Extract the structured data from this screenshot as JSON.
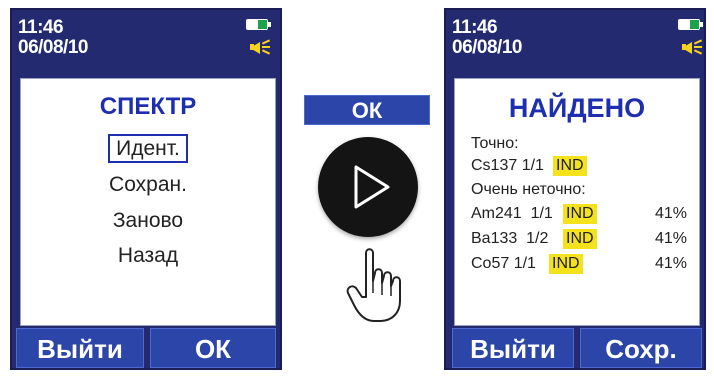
{
  "left_screen": {
    "time": "11:46",
    "date": "06/08/10",
    "title": "СПЕКТР",
    "menu": [
      "Идент.",
      "Сохран.",
      "Заново",
      "Назад"
    ],
    "selected_index": 0,
    "softkeys": {
      "left": "Выйти",
      "right": "ОК"
    }
  },
  "center": {
    "ok_label": "ОК",
    "icons": [
      "play-icon",
      "hand-pointer-icon"
    ]
  },
  "right_screen": {
    "time": "11:46",
    "date": "06/08/10",
    "title": "НАЙДЕНО",
    "exact_label": "Точно:",
    "exact": [
      {
        "nuclide": "Cs137 1/1",
        "tag": "IND"
      }
    ],
    "inexact_label": "Очень неточно:",
    "inexact": [
      {
        "nuclide": "Am241  1/1",
        "tag": "IND",
        "percent": "41%"
      },
      {
        "nuclide": "Ba133  1/2",
        "tag": "IND",
        "percent": "41%"
      },
      {
        "nuclide": "Co57 1/1",
        "tag": "IND",
        "percent": "41%"
      }
    ],
    "softkeys": {
      "left": "Выйти",
      "right": "Сохр."
    }
  },
  "status_icons": [
    "battery-icon",
    "speaker-icon"
  ],
  "colors": {
    "screen_bg": "#242a70",
    "title_blue": "#1d2fb0",
    "softkey_bg": "#2b45a8",
    "highlight": "#f3e21c",
    "battery": "#1aa34a",
    "speaker": "#f6d21b"
  }
}
